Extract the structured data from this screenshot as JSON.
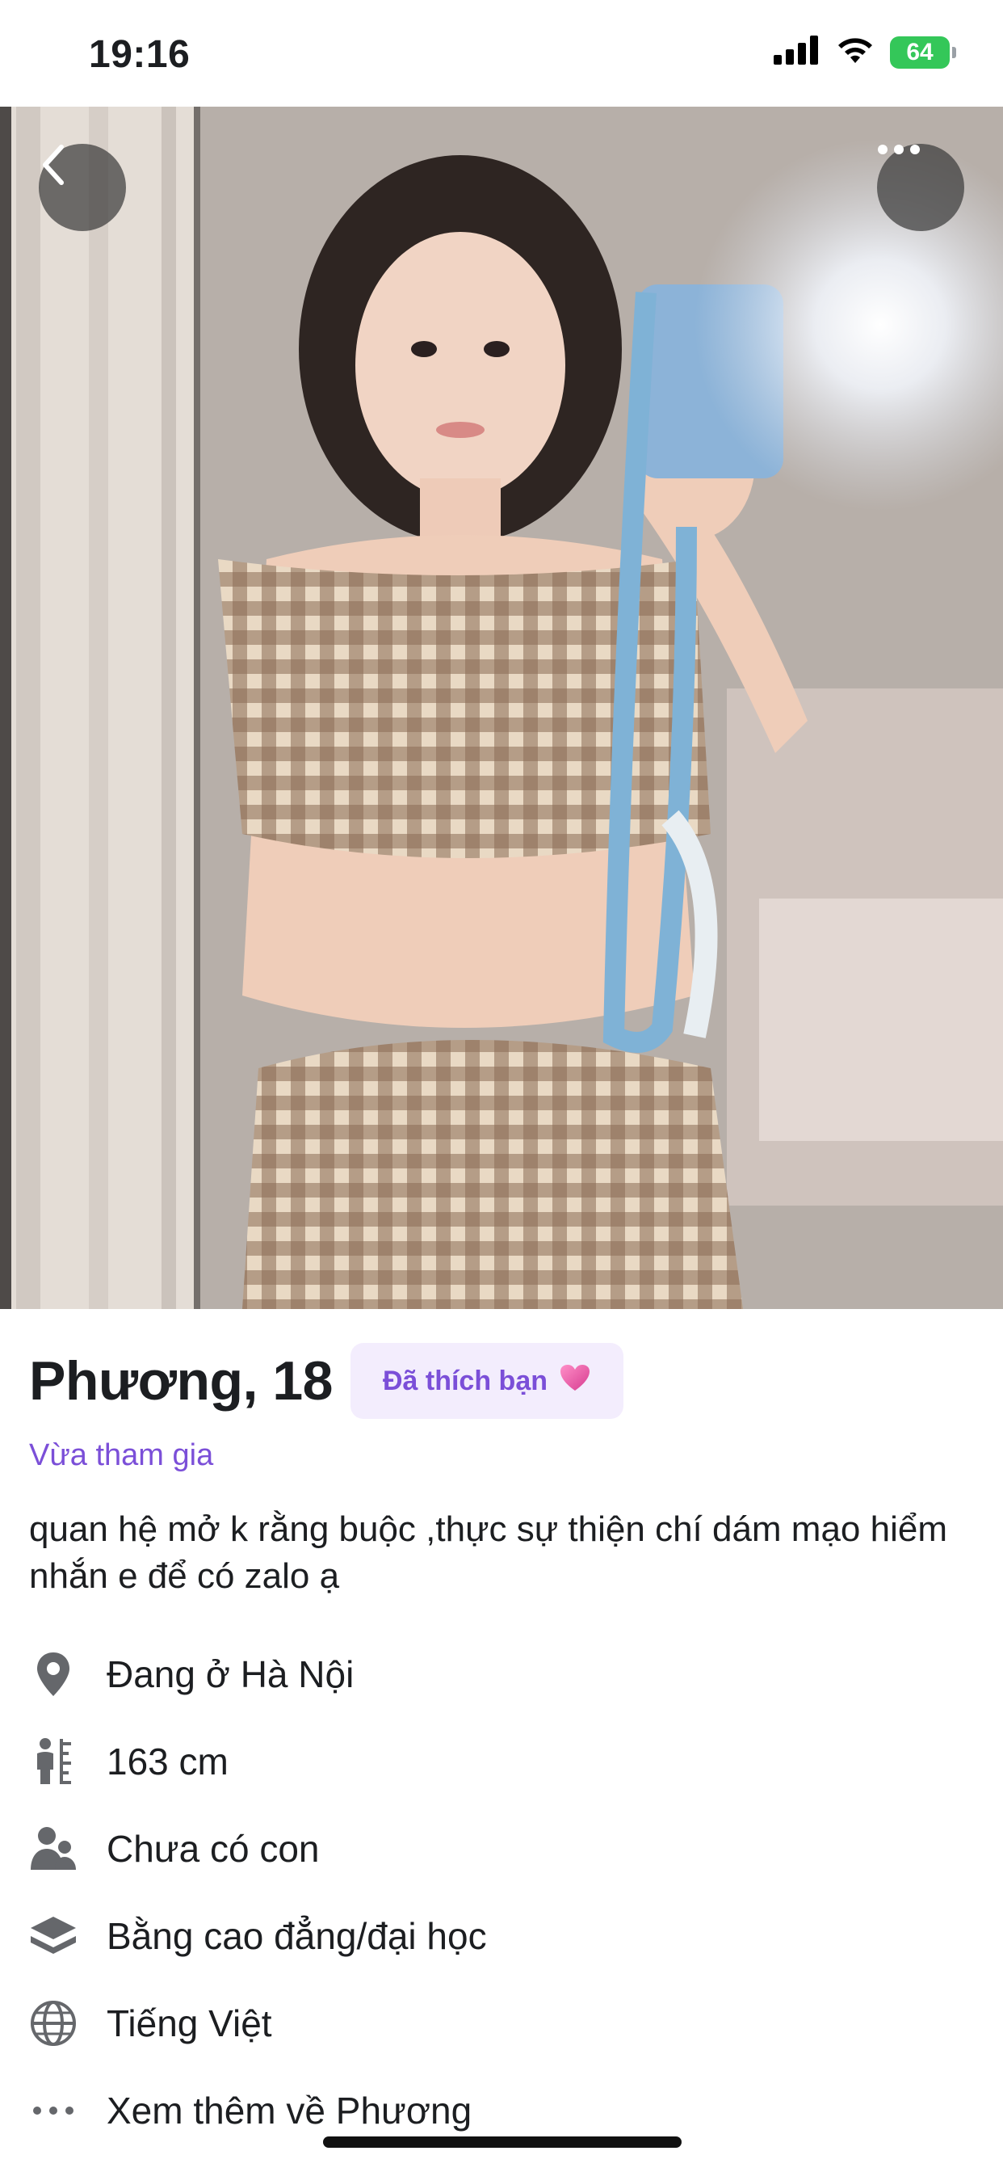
{
  "status_bar": {
    "time": "19:16",
    "battery": "64",
    "icons": [
      "signal-icon",
      "wifi-icon",
      "battery-icon"
    ]
  },
  "photo": {
    "icons": [
      "back-chevron-icon",
      "more-dots-icon"
    ]
  },
  "profile": {
    "name_age": "Phương, 18",
    "liked_badge": "Đã thích bạn",
    "liked_badge_icon": "heart-icon",
    "joined": "Vừa tham gia",
    "bio": "quan hệ mở k rằng buộc ,thực sự thiện chí dám mạo hiểm nhắn e để có zalo ạ",
    "details": [
      {
        "icon": "location-pin-icon",
        "text": "Đang ở Hà Nội"
      },
      {
        "icon": "height-icon",
        "text": "163 cm"
      },
      {
        "icon": "children-icon",
        "text": "Chưa có con"
      },
      {
        "icon": "education-icon",
        "text": "Bằng cao đẳng/đại học"
      },
      {
        "icon": "globe-icon",
        "text": "Tiếng Việt"
      },
      {
        "icon": "more-horizontal-icon",
        "text": "Xem thêm về Phương"
      }
    ]
  },
  "colors": {
    "accent": "#7b4fd8",
    "badge_bg": "#f3edfd",
    "battery": "#34c759",
    "text": "#1c1e21",
    "icon": "#65676b"
  }
}
